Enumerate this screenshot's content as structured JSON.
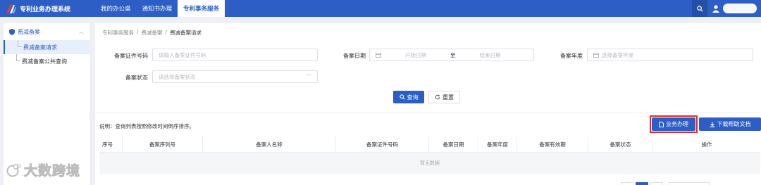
{
  "app": {
    "title": "专利业务办理系统"
  },
  "nav": {
    "items": [
      "我的办公桌",
      "通知书办理",
      "专利事务服务"
    ],
    "active_index": 2
  },
  "sidebar": {
    "group": "费减备案",
    "items": [
      "费减备案请求",
      "费减备案公共查询"
    ],
    "active_index": 0
  },
  "breadcrumb": [
    "专利事务服务",
    "费减备案",
    "费减备案请求"
  ],
  "form": {
    "cert_no_label": "备案证件号码",
    "cert_no_placeholder": "请输入备案证件号码",
    "date_label": "备案日期",
    "date_start_placeholder": "开始日期",
    "date_sep": "至",
    "date_end_placeholder": "结束日期",
    "year_label": "备案年度",
    "year_placeholder": "选择备案年度",
    "status_label": "备案状态",
    "status_placeholder": "请选择备案状态"
  },
  "actions": {
    "query": "查询",
    "reset": "重置",
    "handle": "业务办理",
    "download": "下载帮助文档"
  },
  "note": "说明：查询列表按照修改时间倒序排序。",
  "table": {
    "columns": [
      "序号",
      "备案序列号",
      "备案人名称",
      "备案证件号码",
      "备案日期",
      "备案年度",
      "备案有效期",
      "备案状态",
      "操作"
    ],
    "empty_text": "暂无数据"
  },
  "watermark": "大数跨境",
  "colors": {
    "primary": "#2c5ec6",
    "highlight": "#d9302c"
  }
}
